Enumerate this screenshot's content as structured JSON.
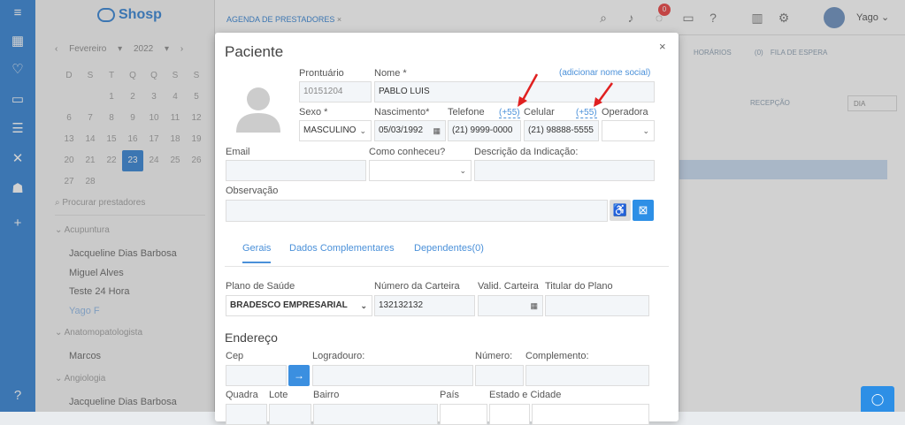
{
  "app": {
    "logo_text": "Shosp",
    "agenda_tab": "AGENDA DE PRESTADORES",
    "notification_count": "0",
    "user_name": "Yago"
  },
  "calendar": {
    "month": "Fevereiro",
    "year": "2022",
    "weekdays": [
      "D",
      "S",
      "T",
      "Q",
      "Q",
      "S",
      "S"
    ],
    "weeks": [
      [
        "",
        "",
        "1",
        "2",
        "3",
        "4",
        "5"
      ],
      [
        "6",
        "7",
        "8",
        "9",
        "10",
        "11",
        "12"
      ],
      [
        "13",
        "14",
        "15",
        "16",
        "17",
        "18",
        "19"
      ],
      [
        "20",
        "21",
        "22",
        "23",
        "24",
        "25",
        "26"
      ],
      [
        "27",
        "28",
        "",
        "",
        "",
        "",
        ""
      ]
    ],
    "selected_day": "23"
  },
  "sidebar": {
    "search_placeholder": "Procurar prestadores",
    "groups": [
      {
        "specialty": "Acupuntura",
        "providers": [
          "Jacqueline Dias Barbosa",
          "Miguel Alves",
          "Teste 24 Hora",
          "Yago F"
        ]
      },
      {
        "specialty": "Anatomopatologista",
        "providers": [
          "Marcos"
        ]
      },
      {
        "specialty": "Angiologia",
        "providers": [
          "Jacqueline Dias Barbosa"
        ]
      }
    ]
  },
  "agenda_bg": {
    "horarios": "HORÁRIOS",
    "fila_count": "(0)",
    "fila": "FILA DE ESPERA",
    "recepcao": "RECEPÇÃO",
    "view": "DIA"
  },
  "modal": {
    "title": "Paciente",
    "close": "×",
    "prontuario_label": "Prontuário",
    "prontuario_value": "10151204",
    "nome_label": "Nome *",
    "nome_value": "PABLO LUIS",
    "social_name_link": "(adicionar nome social)",
    "sexo_label": "Sexo *",
    "sexo_value": "MASCULINO",
    "nascimento_label": "Nascimento*",
    "nascimento_value": "05/03/1992",
    "telefone_label": "Telefone",
    "telefone_ddi": "(+55)",
    "telefone_value": "(21) 9999-0000",
    "celular_label": "Celular",
    "celular_ddi": "(+55)",
    "celular_value": "(21) 98888-5555",
    "operadora_label": "Operadora",
    "operadora_value": "",
    "email_label": "Email",
    "email_value": "",
    "como_conheceu_label": "Como conheceu?",
    "como_conheceu_value": "",
    "descricao_indicacao_label": "Descrição da Indicação:",
    "descricao_indicacao_value": "",
    "observacao_label": "Observação",
    "observacao_value": "",
    "tabs": [
      "Gerais",
      "Dados Complementares",
      "Dependentes(0)"
    ],
    "plano_label": "Plano de Saúde",
    "plano_value": "BRADESCO EMPRESARIAL",
    "carteira_label": "Número da Carteira",
    "carteira_value": "132132132",
    "validade_label": "Valid. Carteira",
    "validade_value": "",
    "titular_label": "Titular do Plano",
    "titular_value": "",
    "endereco_title": "Endereço",
    "cep_label": "Cep",
    "logradouro_label": "Logradouro:",
    "numero_label": "Número:",
    "complemento_label": "Complemento:",
    "quadra_label": "Quadra",
    "lote_label": "Lote",
    "bairro_label": "Bairro",
    "pais_label": "País",
    "estado_cidade_label": "Estado e Cidade"
  }
}
